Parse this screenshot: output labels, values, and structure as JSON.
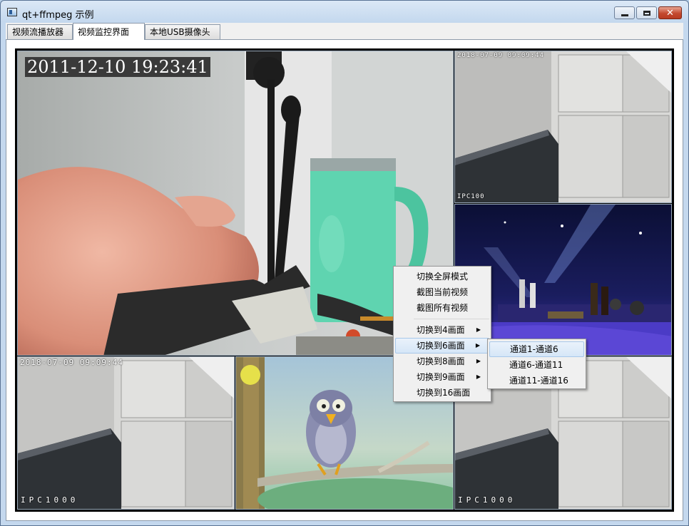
{
  "window": {
    "title": "qt+ffmpeg 示例"
  },
  "tabs": [
    {
      "label": "视频流播放器"
    },
    {
      "label": "视频监控界面"
    },
    {
      "label": "本地USB摄像头"
    }
  ],
  "video_cells": [
    {
      "osd": "2011-12-10  19:23:41"
    },
    {
      "osd_top": "2018-07-09 09:09:44",
      "osd_bottom": "IPC100"
    },
    {
      "osd": ""
    },
    {
      "osd_top": "2018-07-09  09:09:44",
      "osd_bottom": "IPC1000"
    },
    {
      "osd": ""
    },
    {
      "osd_bottom": "IPC1000"
    }
  ],
  "context_menu": {
    "items": [
      {
        "label": "切换全屏模式",
        "submenu": false
      },
      {
        "label": "截图当前视频",
        "submenu": false
      },
      {
        "label": "截图所有视频",
        "submenu": false
      },
      {
        "label": "切换到4画面",
        "submenu": true
      },
      {
        "label": "切换到6画面",
        "submenu": true
      },
      {
        "label": "切换到8画面",
        "submenu": true
      },
      {
        "label": "切换到9画面",
        "submenu": true
      },
      {
        "label": "切换到16画面",
        "submenu": false
      }
    ],
    "submenu": [
      {
        "label": "通道1-通道6"
      },
      {
        "label": "通道6-通道11"
      },
      {
        "label": "通道11-通道16"
      }
    ]
  },
  "colors": {
    "highlight": "#d5e6f7",
    "close_button": "#c4492f"
  }
}
